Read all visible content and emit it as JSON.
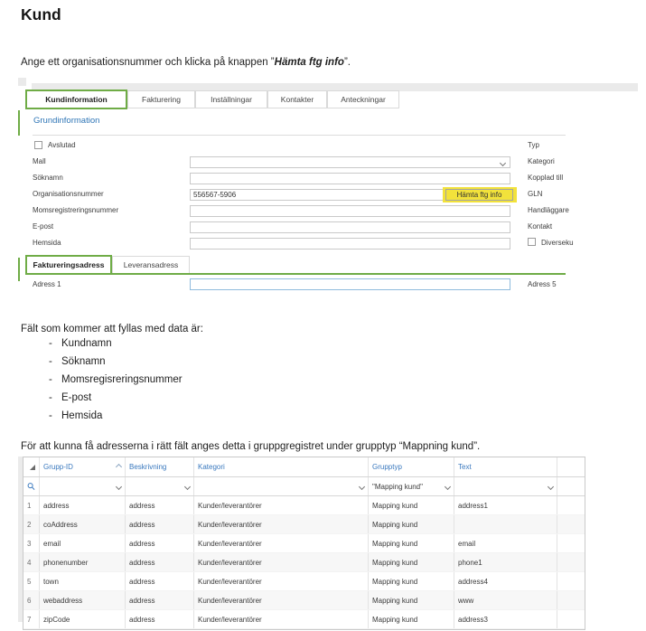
{
  "title": "Kund",
  "intro": {
    "pre": "Ange ett organisationsnummer och klicka på knappen ”",
    "highlight": "Hämta ftg info",
    "post": "”."
  },
  "screenshot": {
    "tabs": [
      "Kundinformation",
      "Fakturering",
      "Inställningar",
      "Kontakter",
      "Anteckningar"
    ],
    "section": "Grundinformation",
    "checkbox_label": "Avslutad",
    "labels_left": [
      "Mall",
      "Söknamn",
      "Organisationsnummer",
      "Momsregistreringsnummer",
      "E-post",
      "Hemsida"
    ],
    "org_value": "556567-5906",
    "button": "Hämta ftg info",
    "labels_right": [
      "Typ",
      "Kategori",
      "Kopplad till",
      "GLN",
      "Handläggare",
      "Kontakt"
    ],
    "checkbox_right_label": "Diverseku",
    "address_tabs": [
      "Faktureringsadress",
      "Leveransadress"
    ],
    "address_left": "Adress 1",
    "address_right": "Adress 5"
  },
  "fields_list": {
    "intro": "Fält som kommer att fyllas med data är:",
    "bullet": "-",
    "items": [
      "Kundnamn",
      "Söknamn",
      "Momsregisreringsnummer",
      "E-post",
      "Hemsida"
    ]
  },
  "mapping_text": "För att kunna få adresserna i rätt fält anges detta i gruppgregistret under grupptyp “Mappning kund”.",
  "grid": {
    "columns": [
      "Grupp-ID",
      "Beskrivning",
      "Kategori",
      "Grupptyp",
      "Text"
    ],
    "filter": {
      "grupptyp": "\"Mapping kund\""
    },
    "rows": [
      [
        "address",
        "address",
        "Kunder/leverantörer",
        "Mapping kund",
        "address1"
      ],
      [
        "coAddress",
        "address",
        "Kunder/leverantörer",
        "Mapping kund",
        ""
      ],
      [
        "email",
        "address",
        "Kunder/leverantörer",
        "Mapping kund",
        "email"
      ],
      [
        "phonenumber",
        "address",
        "Kunder/leverantörer",
        "Mapping kund",
        "phone1"
      ],
      [
        "town",
        "address",
        "Kunder/leverantörer",
        "Mapping kund",
        "address4"
      ],
      [
        "webaddress",
        "address",
        "Kunder/leverantörer",
        "Mapping kund",
        "www"
      ],
      [
        "zipCode",
        "address",
        "Kunder/leverantörer",
        "Mapping kund",
        "address3"
      ]
    ]
  },
  "colors": {
    "green": "#6FAC46",
    "grid_header_blue": "#3978BE",
    "section_blue": "#2E75B6",
    "highlight_yellow": "#F2E23B"
  }
}
